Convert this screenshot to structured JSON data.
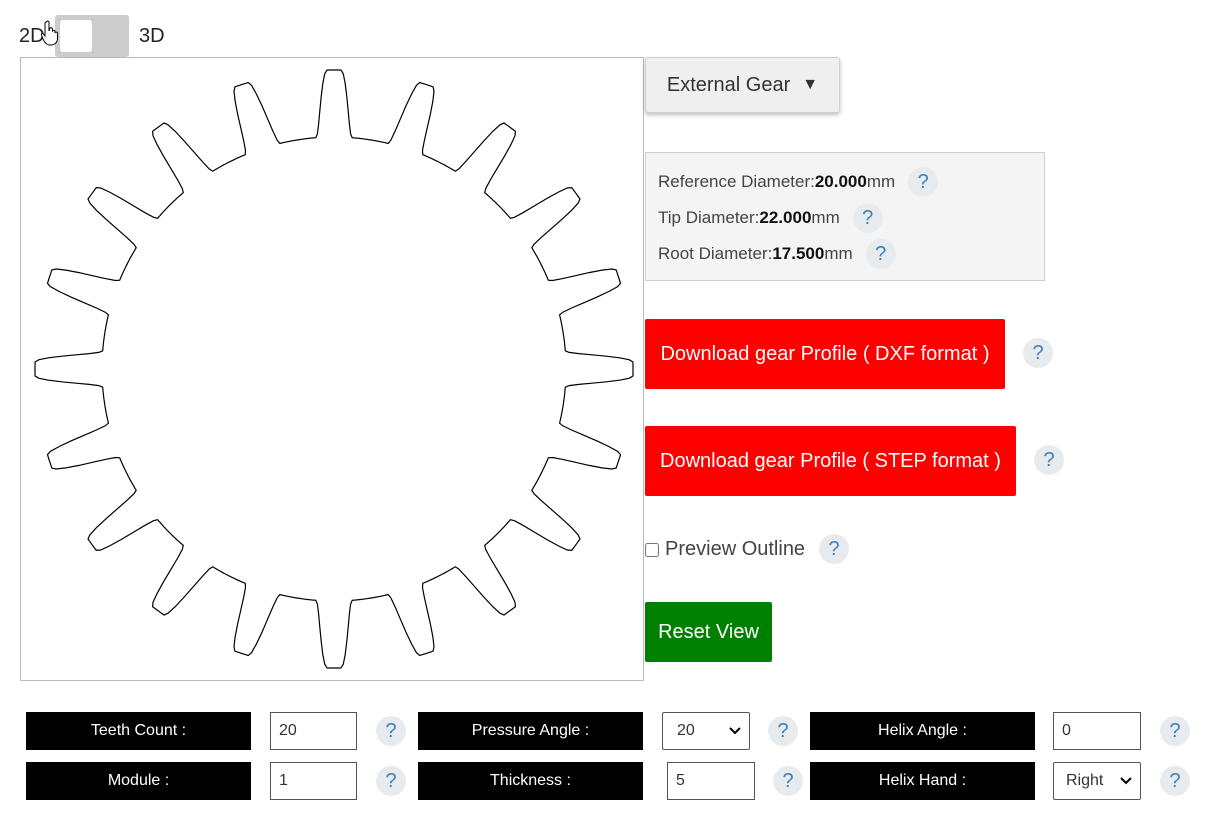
{
  "mode_toggle": {
    "left_label": "2D",
    "right_label": "3D",
    "state": "2D"
  },
  "gear_type": {
    "label": "External Gear",
    "caret": "▼"
  },
  "info": {
    "reference": {
      "label": "Reference Diameter:",
      "value": "20.000",
      "unit": "mm"
    },
    "tip": {
      "label": "Tip Diameter:",
      "value": "22.000",
      "unit": "mm"
    },
    "root": {
      "label": "Root Diameter:",
      "value": "17.500",
      "unit": "mm"
    }
  },
  "help_glyph": "?",
  "buttons": {
    "dxf": "Download gear Profile ( DXF format )",
    "step": "Download gear Profile ( STEP format )",
    "reset": "Reset View"
  },
  "preview_outline": {
    "label": "Preview Outline",
    "checked": false
  },
  "params": {
    "teeth_count": {
      "label": "Teeth Count :",
      "value": "20"
    },
    "pressure_angle": {
      "label": "Pressure Angle :",
      "value": "20"
    },
    "helix_angle": {
      "label": "Helix Angle :",
      "value": "0"
    },
    "module": {
      "label": "Module :",
      "value": "1"
    },
    "thickness": {
      "label": "Thickness :",
      "value": "5"
    },
    "helix_hand": {
      "label": "Helix Hand :",
      "value": "Right"
    }
  },
  "gear_profile": {
    "teeth": 20
  },
  "colors": {
    "download": "#ff0000",
    "reset": "#008000",
    "param_label_bg": "#000000",
    "help_text": "#3b82c4"
  }
}
